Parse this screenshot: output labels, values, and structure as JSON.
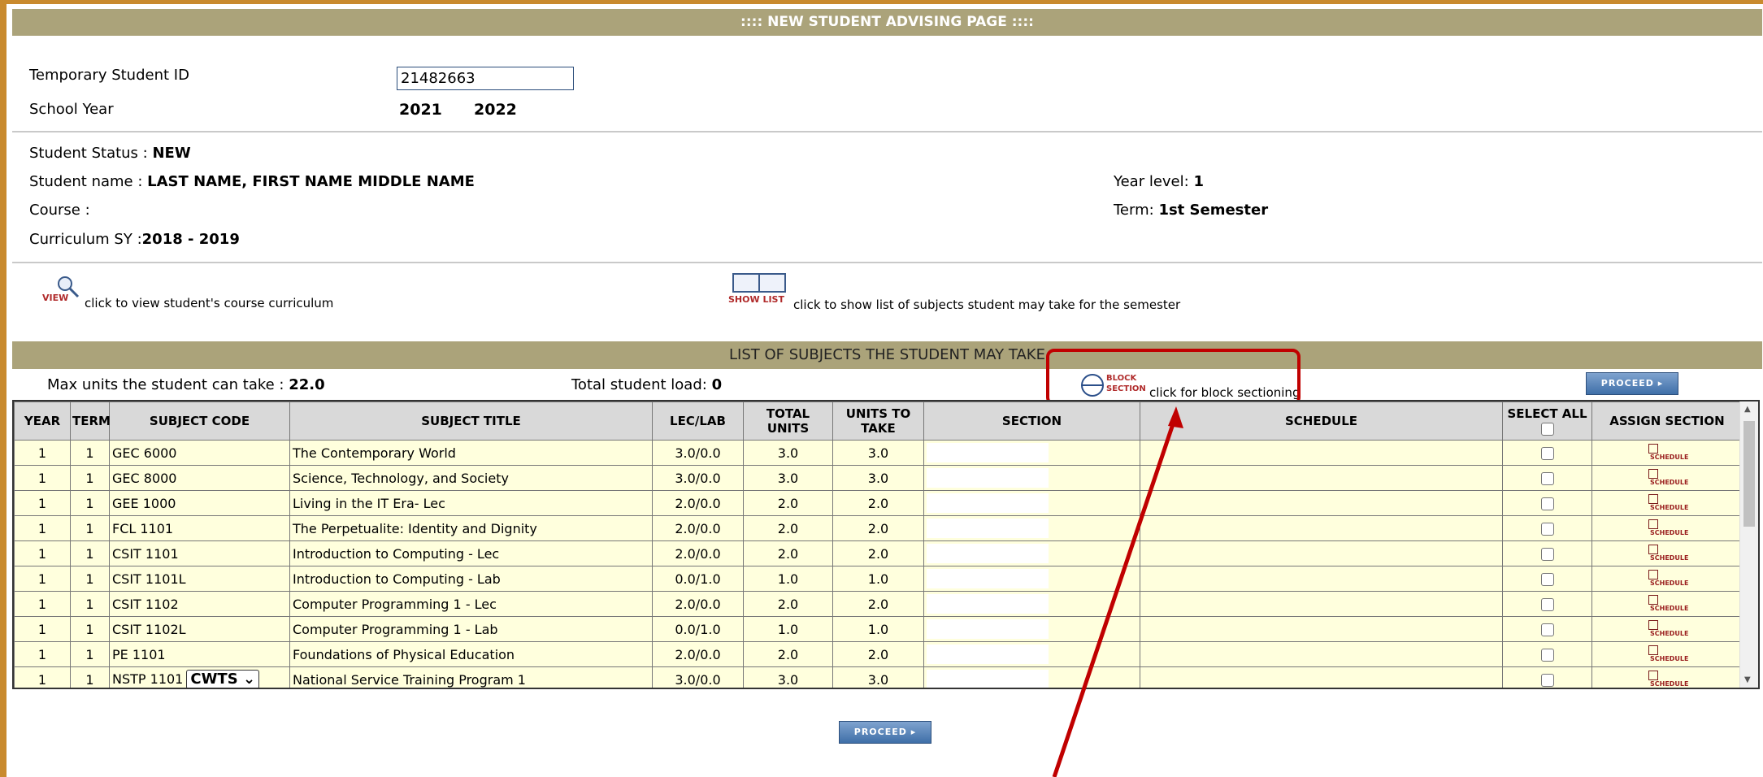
{
  "header": {
    "title": ":::: NEW STUDENT ADVISING PAGE ::::"
  },
  "info": {
    "temp_id_label": "Temporary Student ID",
    "temp_id_value": "21482663",
    "school_year_label": "School Year",
    "school_year_start": "2021",
    "school_year_end": "2022",
    "status_label": "Student Status :",
    "status_value": "NEW",
    "name_label": "Student name :",
    "name_value": "LAST NAME, FIRST NAME MIDDLE NAME",
    "course_label": "Course :",
    "curriculum_label": "Curriculum SY :",
    "curriculum_value": "2018 - 2019",
    "year_level_label": "Year level:",
    "year_level_value": "1",
    "term_label": "Term:",
    "term_value": "1st Semester"
  },
  "links": {
    "view_icon_label": "VIEW",
    "view_text": "click to view student's course curriculum",
    "showlist_icon_label": "SHOW LIST",
    "showlist_text": "click to show list of subjects student may take for the semester",
    "block_icon_label_1": "BLOCK",
    "block_icon_label_2": "SECTION",
    "block_text": "click for block sectioning"
  },
  "list": {
    "title": "LIST OF SUBJECTS THE STUDENT MAY TAKE",
    "max_units_label": "Max units the student can take :",
    "max_units_value": "22.0",
    "total_load_label": "Total student load:",
    "total_load_value": "0",
    "proceed_label": "PROCEED ▸"
  },
  "table": {
    "headers": {
      "year": "YEAR",
      "term": "TERM",
      "code": "SUBJECT CODE",
      "title": "SUBJECT TITLE",
      "leclab": "LEC/LAB",
      "total": "TOTAL UNITS",
      "take": "UNITS TO TAKE",
      "section": "SECTION",
      "schedule": "SCHEDULE",
      "select_all": "SELECT ALL",
      "assign": "ASSIGN SECTION"
    },
    "schedule_icon_label": "SCHEDULE",
    "nstp_option": "CWTS",
    "rows": [
      {
        "year": "1",
        "term": "1",
        "code": "GEC 6000",
        "title": "The Contemporary World",
        "leclab": "3.0/0.0",
        "total": "3.0",
        "take": "3.0"
      },
      {
        "year": "1",
        "term": "1",
        "code": "GEC 8000",
        "title": "Science, Technology, and Society",
        "leclab": "3.0/0.0",
        "total": "3.0",
        "take": "3.0"
      },
      {
        "year": "1",
        "term": "1",
        "code": "GEE 1000",
        "title": "Living in the IT Era- Lec",
        "leclab": "2.0/0.0",
        "total": "2.0",
        "take": "2.0"
      },
      {
        "year": "1",
        "term": "1",
        "code": "FCL 1101",
        "title": "The Perpetualite: Identity and Dignity",
        "leclab": "2.0/0.0",
        "total": "2.0",
        "take": "2.0"
      },
      {
        "year": "1",
        "term": "1",
        "code": "CSIT 1101",
        "title": "Introduction to Computing - Lec",
        "leclab": "2.0/0.0",
        "total": "2.0",
        "take": "2.0"
      },
      {
        "year": "1",
        "term": "1",
        "code": "CSIT 1101L",
        "title": "Introduction to Computing - Lab",
        "leclab": "0.0/1.0",
        "total": "1.0",
        "take": "1.0"
      },
      {
        "year": "1",
        "term": "1",
        "code": "CSIT 1102",
        "title": "Computer Programming 1 - Lec",
        "leclab": "2.0/0.0",
        "total": "2.0",
        "take": "2.0"
      },
      {
        "year": "1",
        "term": "1",
        "code": "CSIT 1102L",
        "title": "Computer Programming 1 - Lab",
        "leclab": "0.0/1.0",
        "total": "1.0",
        "take": "1.0"
      },
      {
        "year": "1",
        "term": "1",
        "code": "PE 1101",
        "title": "Foundations of Physical Education",
        "leclab": "2.0/0.0",
        "total": "2.0",
        "take": "2.0"
      },
      {
        "year": "1",
        "term": "1",
        "code": "NSTP 1101",
        "title": "National Service Training Program 1",
        "leclab": "3.0/0.0",
        "total": "3.0",
        "take": "3.0"
      }
    ]
  },
  "colors": {
    "banner": "#aba37a",
    "frame": "#c98a2e",
    "row_bg": "#ffffdd",
    "callout": "#c00000",
    "button": "#3f6fa8"
  }
}
